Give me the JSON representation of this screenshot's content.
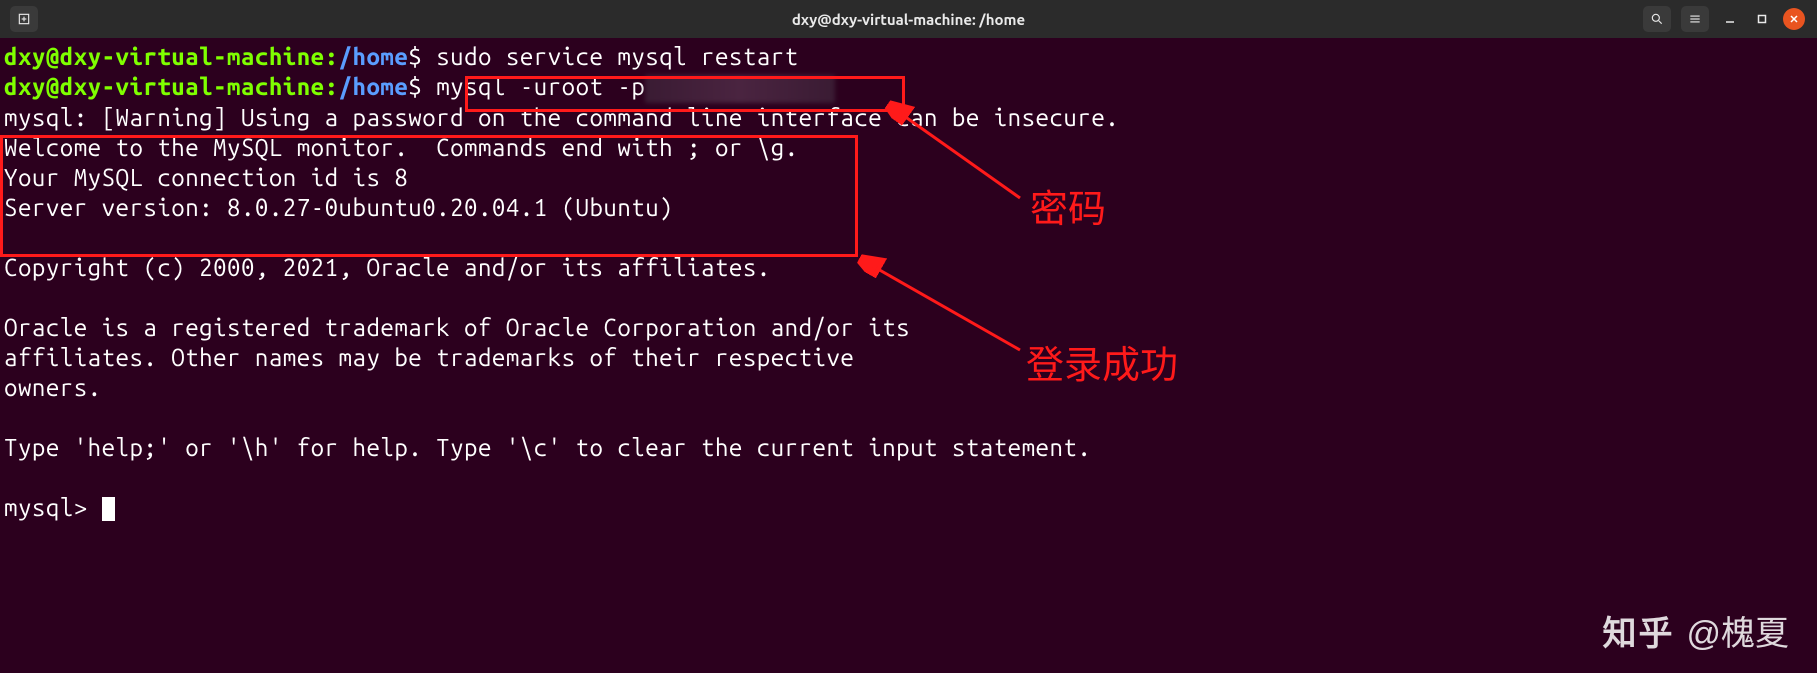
{
  "titlebar": {
    "title": "dxy@dxy-virtual-machine: /home"
  },
  "terminal": {
    "prompt_user": "dxy@dxy-virtual-machine",
    "prompt_sep": ":",
    "prompt_path": "/home",
    "prompt_symbol": "$",
    "cmd1": "sudo service mysql restart",
    "cmd2": "mysql -uroot -p",
    "out_warning": "mysql: [Warning] Using a password on the command line interface can be insecure.",
    "out_welcome": "Welcome to the MySQL monitor.  Commands end with ; or \\g.",
    "out_conn": "Your MySQL connection id is 8",
    "out_version": "Server version: 8.0.27-0ubuntu0.20.04.1 (Ubuntu)",
    "out_copyright": "Copyright (c) 2000, 2021, Oracle and/or its affiliates.",
    "out_trademark1": "Oracle is a registered trademark of Oracle Corporation and/or its",
    "out_trademark2": "affiliates. Other names may be trademarks of their respective",
    "out_trademark3": "owners.",
    "out_help": "Type 'help;' or '\\h' for help. Type '\\c' to clear the current input statement.",
    "mysql_prompt": "mysql> "
  },
  "annotations": {
    "password": "密码",
    "login_success": "登录成功"
  },
  "watermark": {
    "logo": "知乎",
    "author": "@槐夏"
  }
}
